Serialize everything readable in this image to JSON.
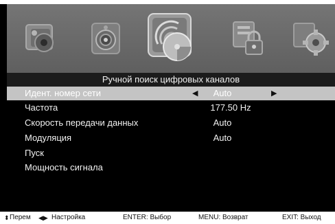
{
  "menu": {
    "icons": [
      "picture-icon",
      "sound-icon",
      "channel-search-icon",
      "lock-icon",
      "settings-icon"
    ],
    "active_icon": "channel-search-icon"
  },
  "header": {
    "title": "Ручной поиск цифровых каналов"
  },
  "rows": [
    {
      "label": "Идент. номер сети",
      "value": "Auto",
      "arrow_left": "◀",
      "arrow_right": "▶",
      "selected": true
    },
    {
      "label": "Частота",
      "value": "177.50 Hz"
    },
    {
      "label": "Скорость передачи данных",
      "value": "Auto"
    },
    {
      "label": "Модуляция",
      "value": "Auto"
    },
    {
      "label": "Пуск",
      "value": ""
    },
    {
      "label": "Мощность сигнала",
      "value": ""
    }
  ],
  "footer": {
    "move_glyph": "⬍",
    "move_label": "Перем",
    "adjust_glyph": "◀▶",
    "adjust_label": "Настройка",
    "enter_label": "ENTER: Выбор",
    "menu_label": "MENU: Возврат",
    "exit_label": "EXIT: Выход"
  },
  "colors": {
    "selected_row": "#c4c4c4",
    "icon_bar": "#6b6b6b",
    "osd_background": "#000000"
  }
}
